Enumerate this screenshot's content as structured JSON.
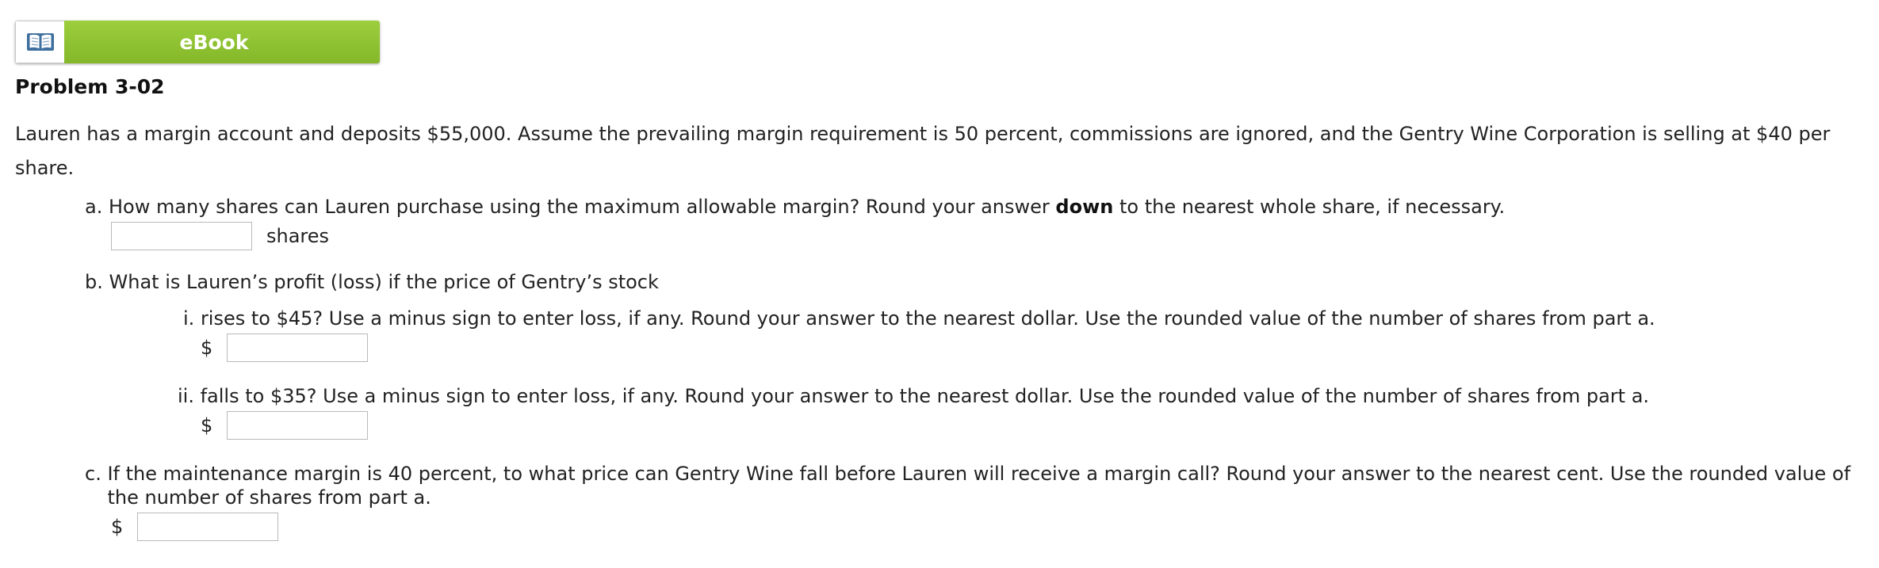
{
  "ebook": {
    "label": "eBook",
    "icon": "open-book-icon"
  },
  "problem": {
    "title": "Problem 3-02",
    "intro": "Lauren has a margin account and deposits $55,000. Assume the prevailing margin requirement is 50 percent, commissions are ignored, and the Gentry Wine Corporation is selling at $40 per share."
  },
  "question_a": {
    "marker": "a.",
    "text_before": "How many shares can Lauren purchase using the maximum allowable margin? Round your answer ",
    "text_bold": "down",
    "text_after": " to the nearest whole share, if necessary.",
    "answer_value": "",
    "unit": "shares"
  },
  "question_b": {
    "marker": "b.",
    "text": "What is Lauren’s profit (loss) if the price of Gentry’s stock",
    "sub_i": {
      "marker": "i.",
      "text": "rises to $45? Use a minus sign to enter loss, if any. Round your answer to the nearest dollar. Use the rounded value of the number of shares from part a.",
      "currency": "$",
      "answer_value": ""
    },
    "sub_ii": {
      "marker": "ii.",
      "text": "falls to $35? Use a minus sign to enter loss, if any. Round your answer to the nearest dollar. Use the rounded value of the number of shares from part a.",
      "currency": "$",
      "answer_value": ""
    }
  },
  "question_c": {
    "marker": "c.",
    "text": "If the maintenance margin is 40 percent, to what price can Gentry Wine fall before Lauren will receive a margin call? Round your answer to the nearest cent. Use the rounded value of the number of shares from part a.",
    "currency": "$",
    "answer_value": ""
  },
  "colors": {
    "ebook_green": "#8fc332",
    "text": "#222222",
    "input_border": "#b9b9b9"
  }
}
